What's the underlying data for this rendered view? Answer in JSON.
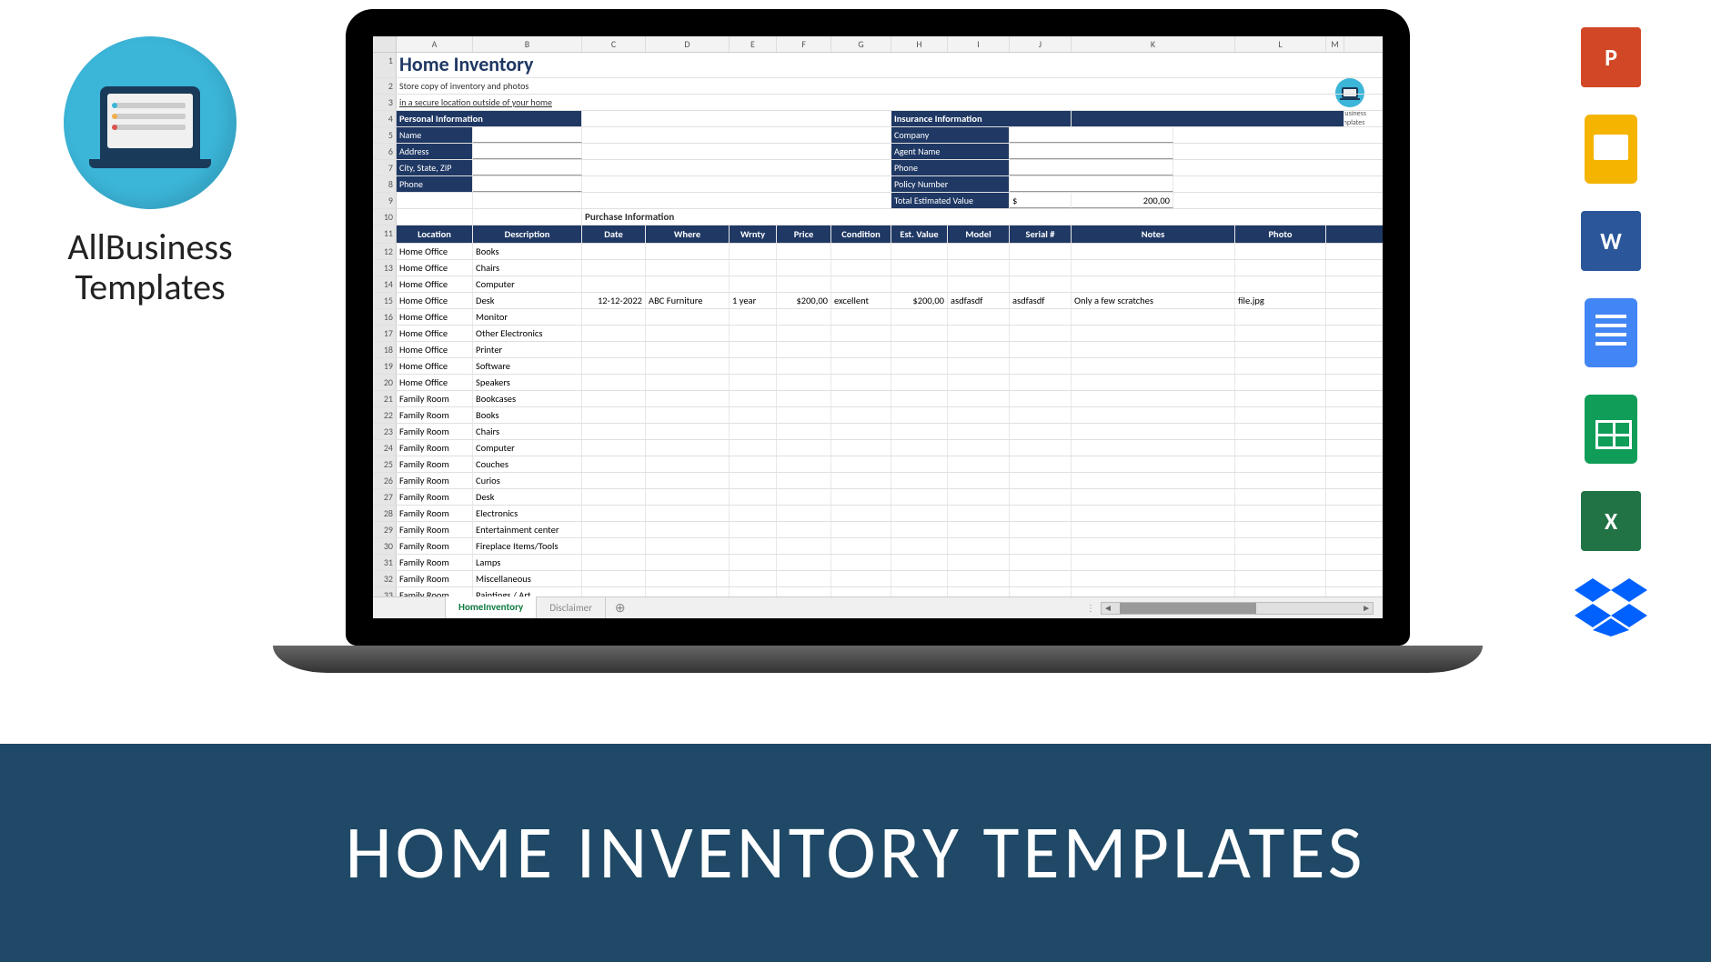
{
  "brand": {
    "name_line1": "AllBusiness",
    "name_line2": "Templates"
  },
  "banner": {
    "title": "HOME INVENTORY TEMPLATES"
  },
  "sheet": {
    "title": "Home Inventory",
    "subtitle1": "Store copy of inventory and photos",
    "subtitle2": "in a secure location outside of your home",
    "columns": [
      "A",
      "B",
      "C",
      "D",
      "E",
      "F",
      "G",
      "H",
      "I",
      "J",
      "K",
      "L",
      "M"
    ],
    "row_numbers": [
      "1",
      "2",
      "3",
      "4",
      "5",
      "6",
      "7",
      "8",
      "9",
      "10",
      "11",
      "12",
      "13",
      "14",
      "15",
      "16",
      "17",
      "18",
      "19",
      "20",
      "21",
      "22",
      "23",
      "24",
      "25",
      "26",
      "27",
      "28",
      "29",
      "30",
      "31",
      "32",
      "33"
    ],
    "personal_info": {
      "header": "Personal Information",
      "fields": [
        "Name",
        "Address",
        "City, State, ZIP",
        "Phone"
      ]
    },
    "insurance_info": {
      "header": "Insurance Information",
      "fields": [
        "Company",
        "Agent Name",
        "Phone",
        "Policy Number",
        "Total Estimated Value"
      ],
      "currency": "$",
      "total": "200,00"
    },
    "purchase_section": "Purchase Information",
    "column_headers": [
      "Location",
      "Description",
      "Date",
      "Where",
      "Wrnty",
      "Price",
      "Condition",
      "Est. Value",
      "Model",
      "Serial #",
      "Notes",
      "Photo"
    ],
    "rows": [
      {
        "location": "Home Office",
        "desc": "Books"
      },
      {
        "location": "Home Office",
        "desc": "Chairs"
      },
      {
        "location": "Home Office",
        "desc": "Computer"
      },
      {
        "location": "Home Office",
        "desc": "Desk",
        "date": "12-12-2022",
        "where": "ABC Furniture",
        "wrnty": "1 year",
        "price": "$200,00",
        "condition": "excellent",
        "est": "$200,00",
        "model": "asdfasdf",
        "serial": "asdfasdf",
        "notes": "Only a few scratches",
        "photo": "file.jpg"
      },
      {
        "location": "Home Office",
        "desc": "Monitor"
      },
      {
        "location": "Home Office",
        "desc": "Other Electronics"
      },
      {
        "location": "Home Office",
        "desc": "Printer"
      },
      {
        "location": "Home Office",
        "desc": "Software"
      },
      {
        "location": "Home Office",
        "desc": "Speakers"
      },
      {
        "location": "Family Room",
        "desc": "Bookcases"
      },
      {
        "location": "Family Room",
        "desc": "Books"
      },
      {
        "location": "Family Room",
        "desc": "Chairs"
      },
      {
        "location": "Family Room",
        "desc": "Computer"
      },
      {
        "location": "Family Room",
        "desc": "Couches"
      },
      {
        "location": "Family Room",
        "desc": "Curios"
      },
      {
        "location": "Family Room",
        "desc": "Desk"
      },
      {
        "location": "Family Room",
        "desc": "Electronics"
      },
      {
        "location": "Family Room",
        "desc": "Entertainment center"
      },
      {
        "location": "Family Room",
        "desc": "Fireplace Items/Tools"
      },
      {
        "location": "Family Room",
        "desc": "Lamps"
      },
      {
        "location": "Family Room",
        "desc": "Miscellaneous"
      },
      {
        "location": "Family Room",
        "desc": "Paintings / Art"
      }
    ],
    "mini_logo": {
      "line1": "AllBusiness",
      "line2": "Templates"
    },
    "tabs": {
      "active": "HomeInventory",
      "inactive": "Disclaimer",
      "add": "⊕"
    }
  },
  "app_icons": {
    "powerpoint": "P",
    "word": "W",
    "excel": "X"
  }
}
